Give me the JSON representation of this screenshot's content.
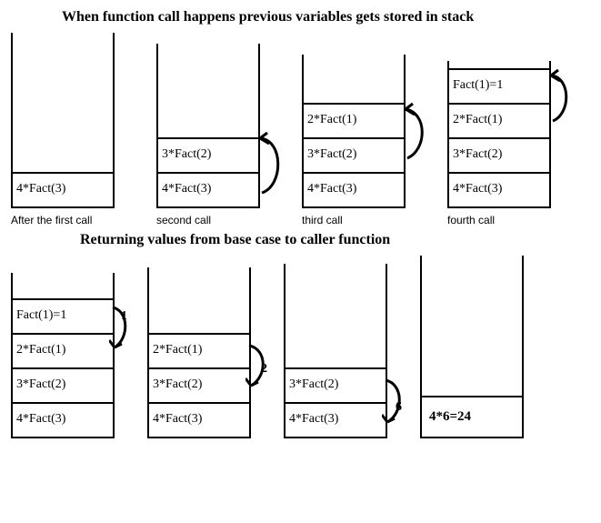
{
  "titles": {
    "push": "When function call happens previous variables gets stored in stack",
    "pop": "Returning values from base case to caller function"
  },
  "frames": {
    "f4": "4*Fact(3)",
    "f3": "3*Fact(2)",
    "f2": "2*Fact(1)",
    "f1": "Fact(1)=1",
    "result": "4*6=24"
  },
  "captions": {
    "c1": "After the first call",
    "c2": "second call",
    "c3": "third call",
    "c4": "fourth call"
  },
  "return_values": {
    "r1": "1",
    "r2": "2",
    "r3": "6"
  }
}
